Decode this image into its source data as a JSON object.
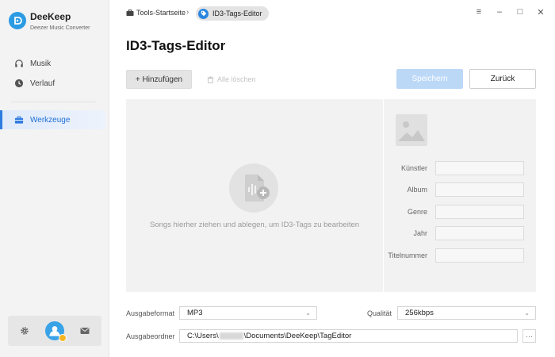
{
  "app": {
    "name": "DeeKeep",
    "subtitle": "Deezer Music Converter"
  },
  "sidebar": {
    "items": [
      {
        "label": "Musik",
        "icon": "headphones-icon"
      },
      {
        "label": "Verlauf",
        "icon": "clock-icon"
      },
      {
        "label": "Werkzeuge",
        "icon": "toolbox-icon",
        "active": true
      }
    ],
    "footer": {
      "settings_icon": "gear-icon",
      "avatar_icon": "user-avatar-icon",
      "mail_icon": "mail-icon"
    }
  },
  "breadcrumb": {
    "home": "Tools-Startseite",
    "separator": "›",
    "current": "ID3-Tags-Editor"
  },
  "window": {
    "menu": "≡",
    "minimize": "–",
    "maximize": "□",
    "close": "✕"
  },
  "page": {
    "title": "ID3-Tags-Editor"
  },
  "toolbar": {
    "add_label": "+ Hinzufügen",
    "clear_label": "Alle löschen",
    "save_label": "Speichern",
    "back_label": "Zurück"
  },
  "dropzone": {
    "hint": "Songs hierher ziehen und ablegen, um ID3-Tags zu bearbeiten"
  },
  "tags": {
    "fields": [
      {
        "label": "Künstler",
        "value": ""
      },
      {
        "label": "Album",
        "value": ""
      },
      {
        "label": "Genre",
        "value": ""
      },
      {
        "label": "Jahr",
        "value": ""
      },
      {
        "label": "Titelnummer",
        "value": ""
      }
    ]
  },
  "output": {
    "format_label": "Ausgabeformat",
    "format_value": "MP3",
    "quality_label": "Qualität",
    "quality_value": "256kbps",
    "folder_label": "Ausgabeordner",
    "folder_prefix": "C:\\Users\\",
    "folder_suffix": "\\Documents\\DeeKeep\\TagEditor",
    "browse_label": "···"
  },
  "colors": {
    "accent": "#2d7be0",
    "save_disabled": "#bcd8f7",
    "panel_bg": "#f2f2f2",
    "sidebar_bg": "#f3f3f3"
  }
}
